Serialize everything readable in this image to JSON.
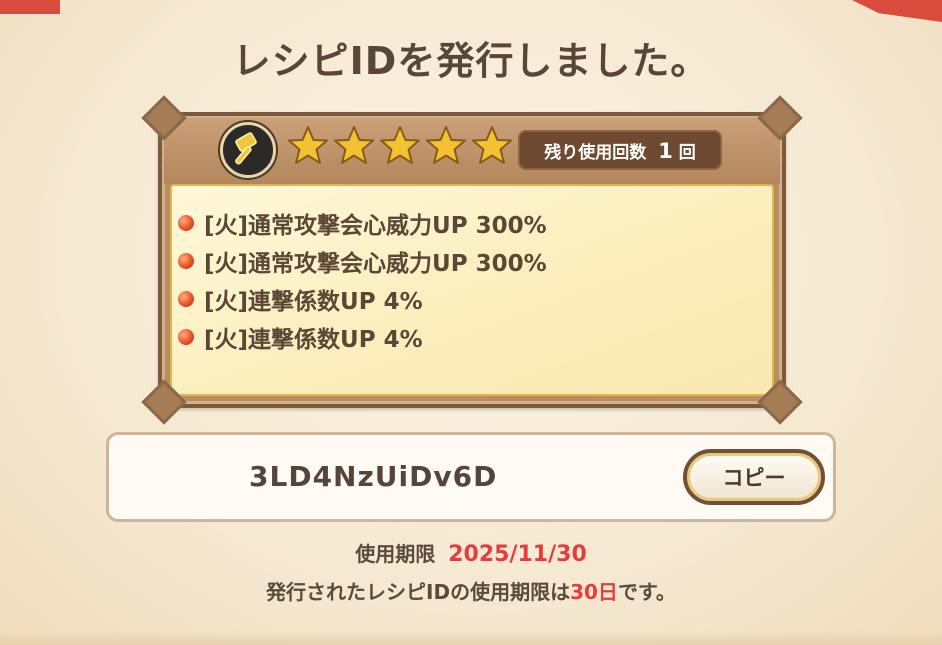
{
  "header": {
    "title": "レシピIDを発行しました。"
  },
  "recipe_card": {
    "icon": "hammer-icon",
    "star_count": 5,
    "uses_label": "残り使用回数",
    "uses_count": "1",
    "uses_unit": "回",
    "effects": [
      "[火]通常攻撃会心威力UP 300%",
      "[火]通常攻撃会心威力UP 300%",
      "[火]連撃係数UP 4%",
      "[火]連撃係数UP 4%"
    ]
  },
  "code_field": {
    "code": "3LD4NzUiDv6D",
    "copy_label": "コピー"
  },
  "expiry": {
    "label": "使用期限",
    "date": "2025/11/30",
    "note_prefix": "発行されたレシピIDの使用期限は",
    "note_days": "30日",
    "note_suffix": "です。"
  },
  "colors": {
    "accent_red": "#e83c3c",
    "text_brown": "#5c4636",
    "gold_star": "#f2c230"
  }
}
